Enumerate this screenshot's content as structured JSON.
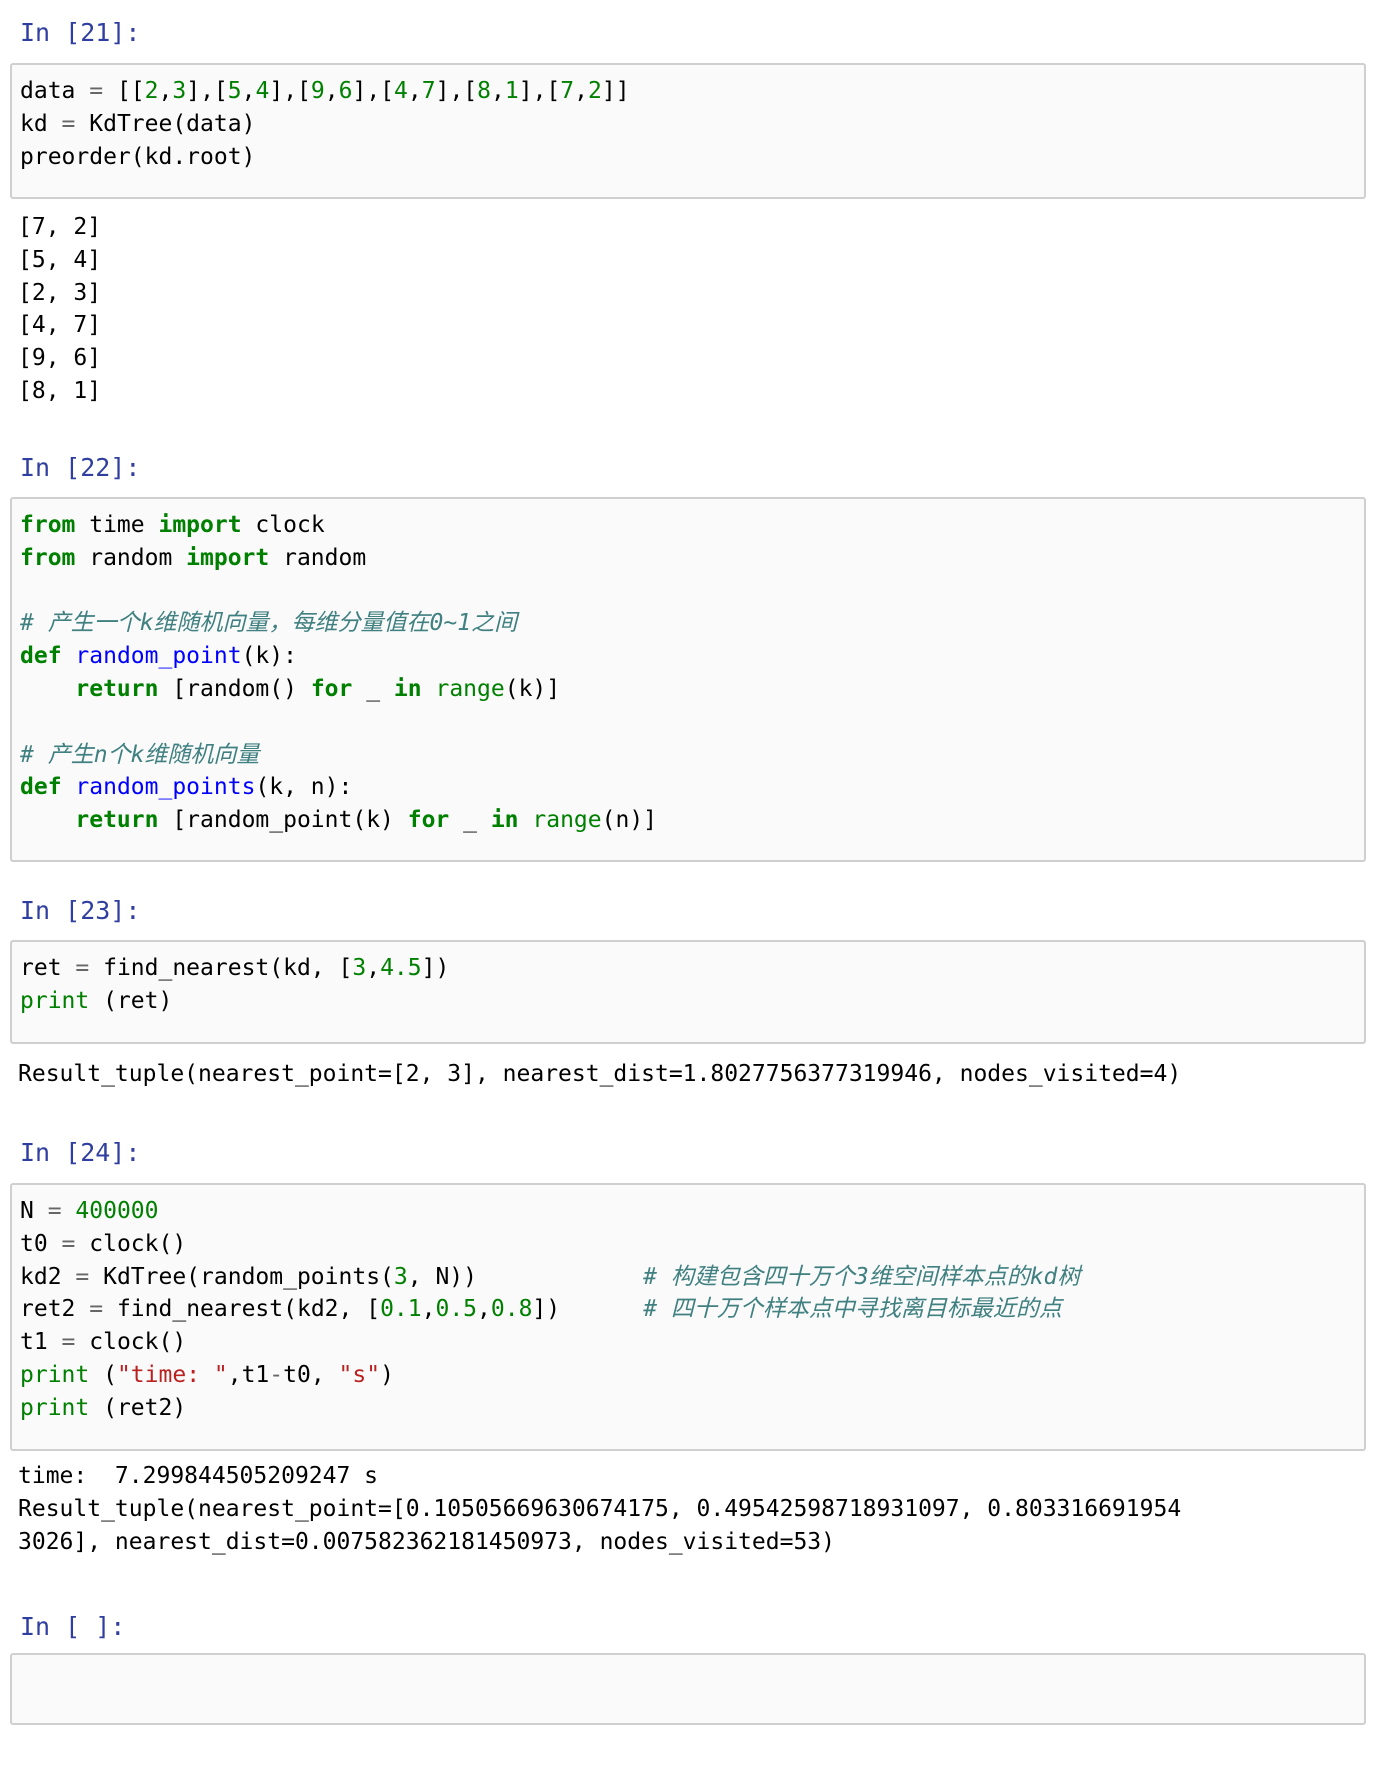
{
  "cells": [
    {
      "prompt": "In [21]:",
      "code": [
        [
          [
            "data ",
            ""
          ],
          [
            "=",
            "op"
          ],
          [
            " [[",
            ""
          ],
          [
            "2",
            "num"
          ],
          [
            ",",
            ""
          ],
          [
            "3",
            "num"
          ],
          [
            "],[",
            ""
          ],
          [
            "5",
            "num"
          ],
          [
            ",",
            ""
          ],
          [
            "4",
            "num"
          ],
          [
            "],[",
            ""
          ],
          [
            "9",
            "num"
          ],
          [
            ",",
            ""
          ],
          [
            "6",
            "num"
          ],
          [
            "],[",
            ""
          ],
          [
            "4",
            "num"
          ],
          [
            ",",
            ""
          ],
          [
            "7",
            "num"
          ],
          [
            "],[",
            ""
          ],
          [
            "8",
            "num"
          ],
          [
            ",",
            ""
          ],
          [
            "1",
            "num"
          ],
          [
            "],[",
            ""
          ],
          [
            "7",
            "num"
          ],
          [
            ",",
            ""
          ],
          [
            "2",
            "num"
          ],
          [
            "]]",
            ""
          ]
        ],
        [
          [
            "kd ",
            ""
          ],
          [
            "=",
            "op"
          ],
          [
            " KdTree(data)",
            ""
          ]
        ],
        [
          [
            "preorder(kd.root)",
            ""
          ]
        ]
      ],
      "output": [
        "[7, 2]",
        "[5, 4]",
        "[2, 3]",
        "[4, 7]",
        "[9, 6]",
        "[8, 1]"
      ]
    },
    {
      "prompt": "In [22]:",
      "code": [
        [
          [
            "from",
            "kw"
          ],
          [
            " time ",
            ""
          ],
          [
            "import",
            "kw"
          ],
          [
            " clock",
            ""
          ]
        ],
        [
          [
            "from",
            "kw"
          ],
          [
            " random ",
            ""
          ],
          [
            "import",
            "kw"
          ],
          [
            " random",
            ""
          ]
        ],
        [],
        [
          [
            "# 产生一个k维随机向量，每维分量值在0~1之间",
            "cm"
          ]
        ],
        [
          [
            "def",
            "kw"
          ],
          [
            " ",
            ""
          ],
          [
            "random_point",
            "fn"
          ],
          [
            "(k):",
            ""
          ]
        ],
        [
          [
            "    ",
            ""
          ],
          [
            "return",
            "kw"
          ],
          [
            " [random() ",
            ""
          ],
          [
            "for",
            "kw"
          ],
          [
            " _ ",
            ""
          ],
          [
            "in",
            "kw"
          ],
          [
            " ",
            ""
          ],
          [
            "range",
            "bi"
          ],
          [
            "(k)]",
            ""
          ]
        ],
        [],
        [
          [
            "# 产生n个k维随机向量",
            "cm"
          ]
        ],
        [
          [
            "def",
            "kw"
          ],
          [
            " ",
            ""
          ],
          [
            "random_points",
            "fn"
          ],
          [
            "(k, n):",
            ""
          ]
        ],
        [
          [
            "    ",
            ""
          ],
          [
            "return",
            "kw"
          ],
          [
            " [random_point(k) ",
            ""
          ],
          [
            "for",
            "kw"
          ],
          [
            " _ ",
            ""
          ],
          [
            "in",
            "kw"
          ],
          [
            " ",
            ""
          ],
          [
            "range",
            "bi"
          ],
          [
            "(n)]",
            ""
          ]
        ]
      ],
      "output": []
    },
    {
      "prompt": "In [23]:",
      "code": [
        [
          [
            "ret ",
            ""
          ],
          [
            "=",
            "op"
          ],
          [
            " find_nearest(kd, [",
            ""
          ],
          [
            "3",
            "num"
          ],
          [
            ",",
            ""
          ],
          [
            "4.5",
            "num"
          ],
          [
            "])",
            ""
          ]
        ],
        [
          [
            "print",
            "bi"
          ],
          [
            " (ret)",
            ""
          ]
        ]
      ],
      "output": [
        "Result_tuple(nearest_point=[2, 3], nearest_dist=1.8027756377319946, nodes_visited=4)"
      ]
    },
    {
      "prompt": "In [24]:",
      "code": [
        [
          [
            "N ",
            ""
          ],
          [
            "=",
            "op"
          ],
          [
            " ",
            ""
          ],
          [
            "400000",
            "num"
          ]
        ],
        [
          [
            "t0 ",
            ""
          ],
          [
            "=",
            "op"
          ],
          [
            " clock()",
            ""
          ]
        ],
        [
          [
            "kd2 ",
            ""
          ],
          [
            "=",
            "op"
          ],
          [
            " KdTree(random_points(",
            ""
          ],
          [
            "3",
            "num"
          ],
          [
            ", N))",
            ""
          ],
          [
            "            ",
            ""
          ],
          [
            "# 构建包含四十万个3维空间样本点的kd树",
            "cm"
          ]
        ],
        [
          [
            "ret2 ",
            ""
          ],
          [
            "=",
            "op"
          ],
          [
            " find_nearest(kd2, [",
            ""
          ],
          [
            "0.1",
            "num"
          ],
          [
            ",",
            ""
          ],
          [
            "0.5",
            "num"
          ],
          [
            ",",
            ""
          ],
          [
            "0.8",
            "num"
          ],
          [
            "])",
            ""
          ],
          [
            "      ",
            ""
          ],
          [
            "# 四十万个样本点中寻找离目标最近的点",
            "cm"
          ]
        ],
        [
          [
            "t1 ",
            ""
          ],
          [
            "=",
            "op"
          ],
          [
            " clock()",
            ""
          ]
        ],
        [
          [
            "print",
            "bi"
          ],
          [
            " (",
            ""
          ],
          [
            "\"time: \"",
            "str"
          ],
          [
            ",t1",
            ""
          ],
          [
            "-",
            "op"
          ],
          [
            "t0, ",
            ""
          ],
          [
            "\"s\"",
            "str"
          ],
          [
            ")",
            ""
          ]
        ],
        [
          [
            "print",
            "bi"
          ],
          [
            " (ret2)",
            ""
          ]
        ]
      ],
      "output": [
        "time:  7.299844505209247 s",
        "Result_tuple(nearest_point=[0.10505669630674175, 0.49542598718931097, 0.803316691954",
        "3026], nearest_dist=0.007582362181450973, nodes_visited=53)"
      ]
    },
    {
      "prompt": "In [ ]:",
      "code": [],
      "output": []
    }
  ]
}
